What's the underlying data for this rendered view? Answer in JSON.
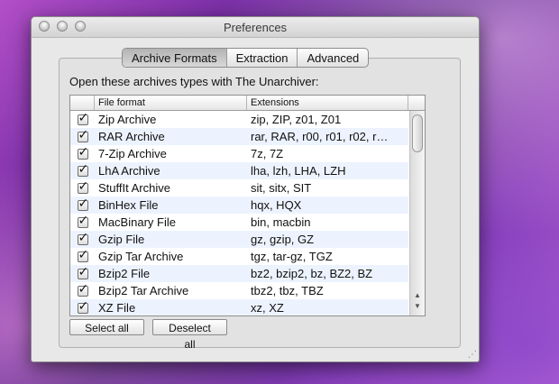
{
  "window": {
    "title": "Preferences"
  },
  "tabs": [
    {
      "label": "Archive Formats",
      "active": true
    },
    {
      "label": "Extraction",
      "active": false
    },
    {
      "label": "Advanced",
      "active": false
    }
  ],
  "intro_text": "Open these archives types with The Unarchiver:",
  "table": {
    "headers": [
      "",
      "File format",
      "Extensions"
    ],
    "rows": [
      {
        "checked": true,
        "format": "Zip Archive",
        "extensions": "zip, ZIP, z01, Z01"
      },
      {
        "checked": true,
        "format": "RAR Archive",
        "extensions": "rar, RAR, r00, r01, r02, r…"
      },
      {
        "checked": true,
        "format": "7-Zip Archive",
        "extensions": "7z, 7Z"
      },
      {
        "checked": true,
        "format": "LhA Archive",
        "extensions": "lha, lzh, LHA, LZH"
      },
      {
        "checked": true,
        "format": "StuffIt Archive",
        "extensions": "sit, sitx, SIT"
      },
      {
        "checked": true,
        "format": "BinHex File",
        "extensions": "hqx, HQX"
      },
      {
        "checked": true,
        "format": "MacBinary File",
        "extensions": "bin, macbin"
      },
      {
        "checked": true,
        "format": "Gzip File",
        "extensions": "gz, gzip, GZ"
      },
      {
        "checked": true,
        "format": "Gzip Tar Archive",
        "extensions": "tgz, tar-gz, TGZ"
      },
      {
        "checked": true,
        "format": "Bzip2 File",
        "extensions": "bz2, bzip2, bz, BZ2, BZ"
      },
      {
        "checked": true,
        "format": "Bzip2 Tar Archive",
        "extensions": "tbz2, tbz, TBZ"
      },
      {
        "checked": true,
        "format": "XZ File",
        "extensions": "xz, XZ"
      }
    ]
  },
  "buttons": {
    "select_all": "Select all",
    "deselect_all": "Deselect all"
  }
}
